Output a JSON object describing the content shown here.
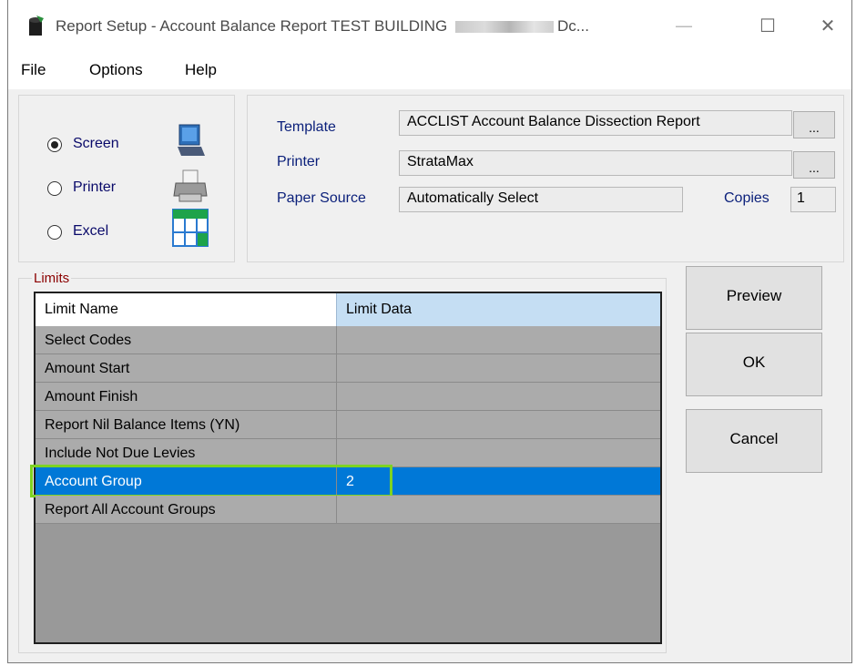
{
  "window": {
    "title_prefix": "Report Setup - Account Balance Report TEST BUILDING",
    "title_suffix": "Dc...",
    "minimize": "—",
    "maximize": "☐",
    "close": "✕"
  },
  "menu": [
    "File",
    "Options",
    "Help"
  ],
  "output": {
    "options": [
      {
        "label": "Screen",
        "checked": true,
        "icon": "monitor-icon"
      },
      {
        "label": "Printer",
        "checked": false,
        "icon": "printer-icon"
      },
      {
        "label": "Excel",
        "checked": false,
        "icon": "spreadsheet-icon"
      }
    ]
  },
  "settings": {
    "template_label": "Template",
    "template_value": "ACCLIST Account Balance Dissection Report",
    "printer_label": "Printer",
    "printer_value": "StrataMax",
    "paper_label": "Paper Source",
    "paper_value": "Automatically Select",
    "copies_label": "Copies",
    "copies_value": "1",
    "browse_label": "..."
  },
  "limits": {
    "legend": "Limits",
    "headers": [
      "Limit Name",
      "Limit Data"
    ],
    "rows": [
      {
        "name": "Select Codes",
        "data": ""
      },
      {
        "name": "Amount Start",
        "data": ""
      },
      {
        "name": "Amount Finish",
        "data": ""
      },
      {
        "name": "Report Nil Balance Items (YN)",
        "data": ""
      },
      {
        "name": "Include Not Due Levies",
        "data": ""
      },
      {
        "name": "Account Group",
        "data": "2",
        "selected": true
      },
      {
        "name": "Report All Account Groups",
        "data": ""
      }
    ]
  },
  "buttons": {
    "preview": "Preview",
    "ok": "OK",
    "cancel": "Cancel"
  },
  "colors": {
    "selection": "#0078d7",
    "highlight_border": "#7ed321",
    "header_data_bg": "#c5def3",
    "row_bg": "#ababab"
  }
}
